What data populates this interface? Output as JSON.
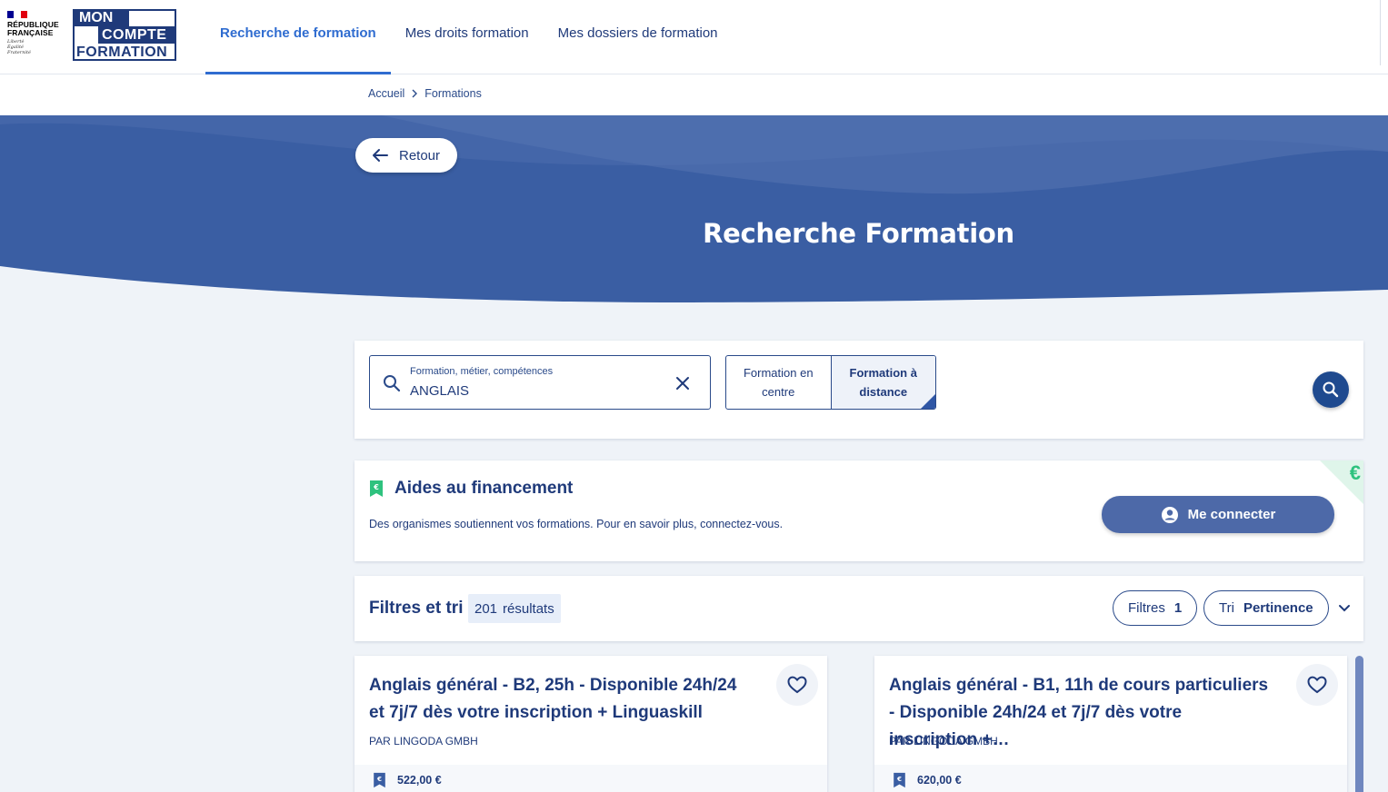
{
  "header": {
    "republique_line1": "RÉPUBLIQUE",
    "republique_line2": "FRANÇAISE",
    "motto": [
      "Liberté",
      "Égalité",
      "Fraternité"
    ],
    "logo_mon": "MON",
    "logo_compte": "COMPTE",
    "logo_formation": "FORMATION",
    "nav": [
      {
        "label": "Recherche de formation",
        "active": true
      },
      {
        "label": "Mes droits formation",
        "active": false
      },
      {
        "label": "Mes dossiers de formation",
        "active": false
      }
    ]
  },
  "breadcrumb": {
    "home": "Accueil",
    "current": "Formations"
  },
  "hero": {
    "back_label": "Retour",
    "title": "Recherche Formation"
  },
  "search": {
    "field_label": "Formation, métier, compétences",
    "field_value": "ANGLAIS",
    "option_centre": "Formation en centre",
    "option_distance": "Formation à distance",
    "selected_option": "Formation à distance"
  },
  "aid": {
    "title": "Aides au financement",
    "text": "Des organismes soutiennent vos formations. Pour en savoir plus, connectez-vous.",
    "euro": "€",
    "login_label": "Me connecter"
  },
  "filters": {
    "title": "Filtres et tri",
    "results_count": "201",
    "results_label": "résultats",
    "filters_label": "Filtres",
    "filters_count": "1",
    "sort_label": "Tri",
    "sort_value": "Pertinence"
  },
  "results": [
    {
      "title": "Anglais général - B2, 25h - Disponible 24h/24 et 7j/7 dès votre inscription + Linguaskill",
      "org": "PAR LINGODA GMBH",
      "price": "522,00 €"
    },
    {
      "title": "Anglais général - B1, 11h de cours particuliers - Disponible 24h/24 et 7j/7 dès votre inscription +…",
      "org": "PAR LINGODA GMBH",
      "price": "620,00 €"
    }
  ],
  "colors": {
    "primary": "#1f3a7a",
    "accent": "#2f6cd0",
    "hero": "#3a5ea3",
    "green": "#2ec27e"
  }
}
